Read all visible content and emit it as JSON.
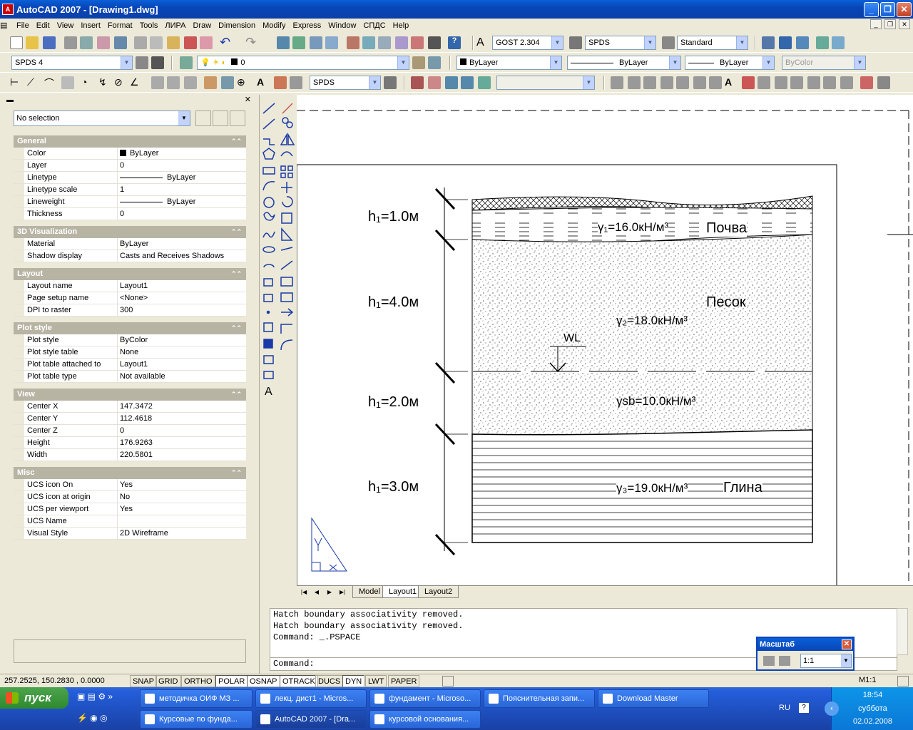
{
  "window": {
    "title": "AutoCAD 2007 - [Drawing1.dwg]",
    "icon": "autocad-icon"
  },
  "menu": [
    "File",
    "Edit",
    "View",
    "Insert",
    "Format",
    "Tools",
    "ЛИРА",
    "Draw",
    "Dimension",
    "Modify",
    "Express",
    "Window",
    "СПДС",
    "Help"
  ],
  "toolbar": {
    "text_style": "GOST 2.304",
    "dim_style": "SPDS",
    "table_style": "Standard",
    "workspace": "SPDS 4",
    "layer": "0",
    "color": "ByLayer",
    "linetype": "ByLayer",
    "lineweight": "ByLayer",
    "plotstyle": "ByColor",
    "dim_style2": "SPDS"
  },
  "properties": {
    "selection": "No selection",
    "categories": [
      {
        "name": "General",
        "rows": [
          {
            "k": "Color",
            "v": "ByLayer"
          },
          {
            "k": "Layer",
            "v": "0"
          },
          {
            "k": "Linetype",
            "v": "ByLayer"
          },
          {
            "k": "Linetype scale",
            "v": "1"
          },
          {
            "k": "Lineweight",
            "v": "ByLayer"
          },
          {
            "k": "Thickness",
            "v": "0"
          }
        ]
      },
      {
        "name": "3D Visualization",
        "rows": [
          {
            "k": "Material",
            "v": "ByLayer"
          },
          {
            "k": "Shadow display",
            "v": "Casts and Receives Shadows"
          }
        ]
      },
      {
        "name": "Layout",
        "rows": [
          {
            "k": "Layout name",
            "v": "Layout1"
          },
          {
            "k": "Page setup name",
            "v": "<None>"
          },
          {
            "k": "DPI to raster",
            "v": "300"
          }
        ]
      },
      {
        "name": "Plot style",
        "rows": [
          {
            "k": "Plot style",
            "v": "ByColor"
          },
          {
            "k": "Plot style table",
            "v": "None"
          },
          {
            "k": "Plot table attached to",
            "v": "Layout1"
          },
          {
            "k": "Plot table type",
            "v": "Not available"
          }
        ]
      },
      {
        "name": "View",
        "rows": [
          {
            "k": "Center X",
            "v": "147.3472"
          },
          {
            "k": "Center Y",
            "v": "112.4618"
          },
          {
            "k": "Center Z",
            "v": "0"
          },
          {
            "k": "Height",
            "v": "176.9263"
          },
          {
            "k": "Width",
            "v": "220.5801"
          }
        ]
      },
      {
        "name": "Misc",
        "rows": [
          {
            "k": "UCS icon On",
            "v": "Yes"
          },
          {
            "k": "UCS icon at origin",
            "v": "No"
          },
          {
            "k": "UCS per viewport",
            "v": "Yes"
          },
          {
            "k": "UCS Name",
            "v": ""
          },
          {
            "k": "Visual Style",
            "v": "2D Wireframe"
          }
        ]
      }
    ]
  },
  "drawing": {
    "layers": [
      {
        "h": "h₁=1.0м",
        "g": "γ₁=16.0кН/м³",
        "name": "Почва"
      },
      {
        "h": "h₁=4.0м",
        "g": "γ₂=18.0кН/м³",
        "name": "Песок"
      },
      {
        "h": "h₁=2.0м",
        "g": "γsb=10.0кН/м³",
        "name": ""
      },
      {
        "h": "h₁=3.0м",
        "g": "γ₃=19.0кН/м³",
        "name": "Глина"
      }
    ],
    "wl": "WL"
  },
  "tabs": [
    "Model",
    "Layout1",
    "Layout2"
  ],
  "command": {
    "lines": [
      "Hatch boundary associativity removed.",
      "Hatch boundary associativity removed.",
      "Command: _.PSPACE"
    ],
    "prompt": "Command:"
  },
  "scale_panel": {
    "title": "Масштаб",
    "value": "1:1"
  },
  "status": {
    "coords": "257.2525,  150.2830 , 0.0000",
    "buttons": [
      "SNAP",
      "GRID",
      "ORTHO",
      "POLAR",
      "OSNAP",
      "OTRACK",
      "DUCS",
      "DYN",
      "LWT",
      "PAPER"
    ],
    "scale": "M1:1"
  },
  "taskbar": {
    "start": "пуск",
    "row1": [
      "методичка ОИФ МЗ ...",
      "лекц. дист1 - Micros...",
      "фундамент - Microso...",
      "Пояснительная запи...",
      "Download Master"
    ],
    "row2": [
      "Курсовые по фунда...",
      "AutoCAD 2007 - [Dra...",
      "курсовой основания..."
    ],
    "lang": "RU",
    "time": "18:54",
    "day": "суббота",
    "date": "02.02.2008"
  }
}
